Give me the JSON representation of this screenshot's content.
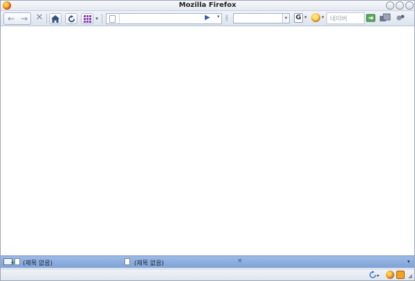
{
  "window": {
    "title": "Mozilla Firefox"
  },
  "toolbar": {
    "back_icon": "back-arrow-icon",
    "forward_icon": "forward-arrow-icon",
    "stop_icon": "stop-x-icon",
    "home_icon": "home-icon",
    "reload_icon": "reload-icon",
    "speed_dial_icon": "grid-icon",
    "url_value": "",
    "search_value": "",
    "google_label": "G",
    "naver_placeholder": "네이버"
  },
  "tabs": [
    {
      "label": "(제목 없음)"
    },
    {
      "label": "(제목 없음)"
    }
  ],
  "colors": {
    "accent": "#7ea2d6",
    "toolbar": "#dde4ee"
  }
}
